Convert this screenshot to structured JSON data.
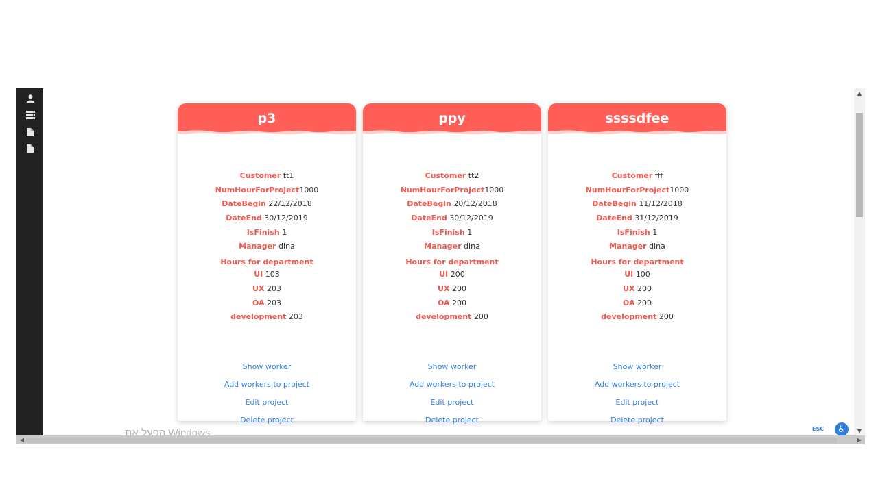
{
  "sidebar": {
    "items": [
      {
        "icon": "user-icon"
      },
      {
        "icon": "server-icon"
      },
      {
        "icon": "file-icon"
      },
      {
        "icon": "file-icon"
      }
    ]
  },
  "labels": {
    "customer": "Customer",
    "num_hours": "NumHourForProject",
    "date_begin": "DateBegin",
    "date_end": "DateEnd",
    "is_finish": "IsFinish",
    "manager": "Manager",
    "hours_dept": "Hours for department",
    "ui": "UI",
    "ux": "UX",
    "oa": "OA",
    "development": "development"
  },
  "links": {
    "show_worker": "Show worker",
    "add_workers": "Add workers to project",
    "edit": "Edit project",
    "delete": "Delete project"
  },
  "projects": [
    {
      "name": "p3",
      "customer": "tt1",
      "num_hours": "1000",
      "date_begin": "22/12/2018",
      "date_end": "30/12/2019",
      "is_finish": "1",
      "manager": "dina",
      "ui": "103",
      "ux": "203",
      "oa": "203",
      "development": "203"
    },
    {
      "name": "ppy",
      "customer": "tt2",
      "num_hours": "1000",
      "date_begin": "20/12/2018",
      "date_end": "30/12/2019",
      "is_finish": "1",
      "manager": "dina",
      "ui": "200",
      "ux": "200",
      "oa": "200",
      "development": "200"
    },
    {
      "name": "ssssdfee",
      "customer": "fff",
      "num_hours": "1000",
      "date_begin": "11/12/2018",
      "date_end": "31/12/2019",
      "is_finish": "1",
      "manager": "dina",
      "ui": "100",
      "ux": "200",
      "oa": "200",
      "development": "200"
    }
  ],
  "footer": {
    "watermark": "הפעל את Windows",
    "esc": "ESC"
  },
  "colors": {
    "header": "#ff5f57",
    "label": "#f05a50",
    "link": "#2f7fe0",
    "sidebar": "#222222"
  }
}
